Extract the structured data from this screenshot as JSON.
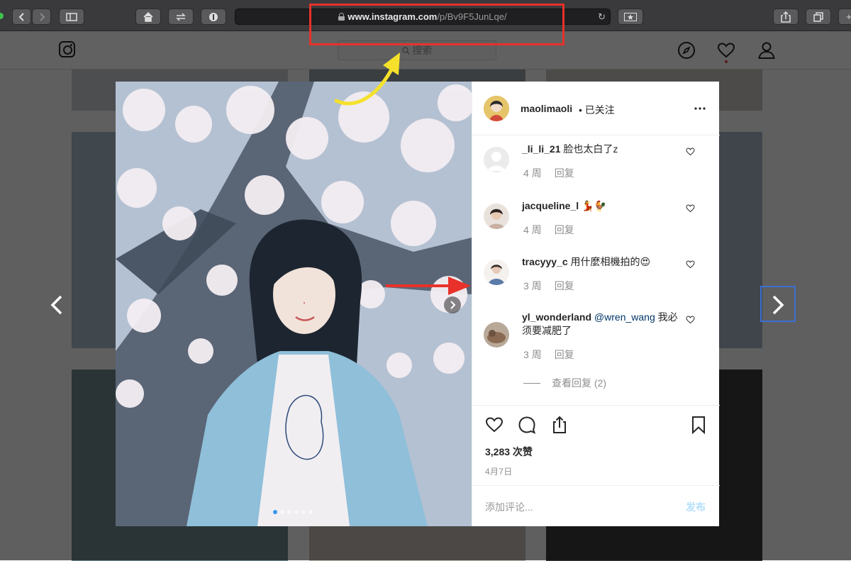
{
  "browser": {
    "url_domain": "www.instagram.com",
    "url_path": "/p/Bv9F5JunLqe/"
  },
  "ig_header": {
    "search_placeholder": "搜索"
  },
  "post": {
    "username": "maolimaoli",
    "follow_status": "• 已关注",
    "likes": "3,283 次赞",
    "date": "4月7日",
    "comment_placeholder": "添加评论...",
    "post_button": "发布",
    "view_replies": "查看回复 (2)",
    "comments": [
      {
        "user": "_li_li_21",
        "text": "脸也太白了z",
        "time": "4 周",
        "reply": "回复"
      },
      {
        "user": "jacqueline_l",
        "text": "💃🐓",
        "time": "4 周",
        "reply": "回复"
      },
      {
        "user": "tracyyy_c",
        "text": "用什麼相機拍的😍",
        "time": "3 周",
        "reply": "回复"
      },
      {
        "user": "yl_wonderland",
        "mention": "@wren_wang",
        "text": "我必须要减肥了",
        "time": "3 周",
        "reply": "回复"
      }
    ],
    "carousel": {
      "total": 6,
      "active": 0
    }
  },
  "colors": {
    "annotation_red": "#e8312a",
    "annotation_yellow": "#f5e12a",
    "annotation_blue": "#3b6fd1",
    "link_blue": "#003569"
  }
}
